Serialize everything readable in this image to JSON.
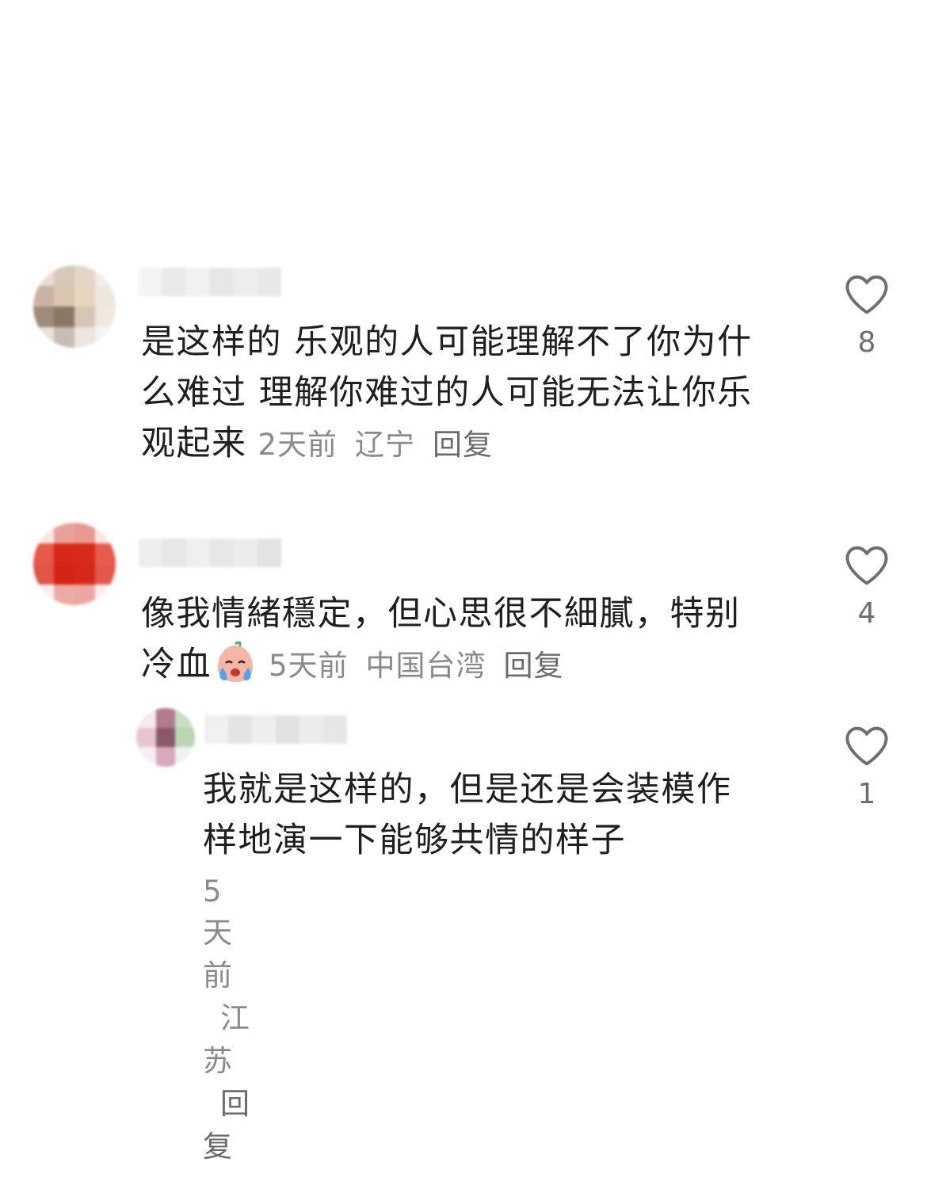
{
  "comments": [
    {
      "text": "是这样的 乐观的人可能理解不了你为什么难过 理解你难过的人可能无法让你乐观起来",
      "lines": [
        "是这样的 乐观的人可能理解不了你为什",
        "么难过 理解你难过的人可能无法让你乐",
        "观起来"
      ],
      "time": "2天前",
      "location": "辽宁",
      "reply_label": "回复",
      "likes": "8"
    },
    {
      "text": "像我情緒穩定，但心思很不細膩，特別冷血",
      "lines": [
        "像我情緒穩定，但心思很不細膩，特别",
        "冷血"
      ],
      "emoji": "crying-face-emoji",
      "time": "5天前",
      "location": "中国台湾",
      "reply_label": "回复",
      "likes": "4"
    },
    {
      "text": "我就是这样的，但是还是会装模作样地演一下能够共情的样子",
      "lines": [
        "我就是这样的，但是还是会装模作",
        "样地演一下能够共情的样子"
      ],
      "time": "5天前",
      "location": "江苏",
      "reply_label": "回复",
      "likes": "1"
    }
  ],
  "icons": {
    "like": "heart-outline-icon"
  },
  "colors": {
    "text": "#1f1f1f",
    "meta": "#8a8a8a",
    "icon": "#6e6e6e"
  }
}
